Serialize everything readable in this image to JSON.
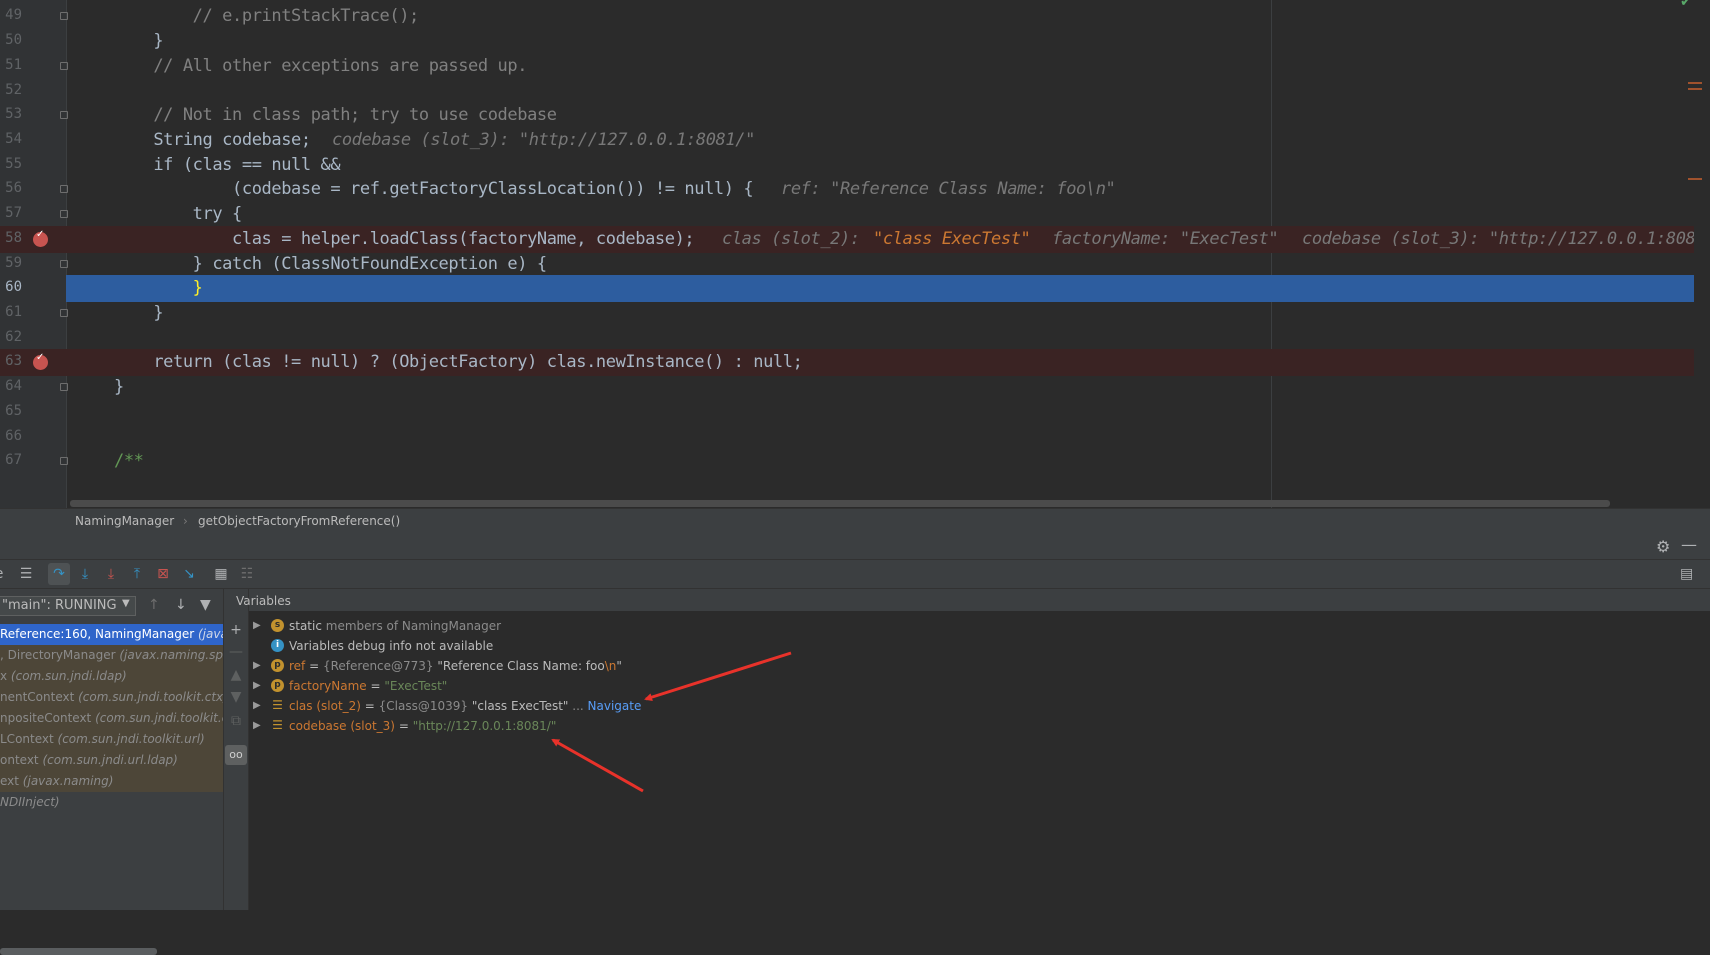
{
  "editor": {
    "lines": [
      {
        "num": "49",
        "code": "        // e.printStackTrace();"
      },
      {
        "num": "50",
        "code": "    }"
      },
      {
        "num": "51",
        "code": "    // All other exceptions are passed up."
      },
      {
        "num": "52",
        "code": ""
      },
      {
        "num": "53",
        "code": "    // Not in class path; try to use codebase"
      },
      {
        "num": "54",
        "code": "    String codebase;",
        "inlay": "codebase (slot_3): \"http://127.0.0.1:8081/\""
      },
      {
        "num": "55",
        "code": "    if (clas == null &&"
      },
      {
        "num": "56",
        "code": "            (codebase = ref.getFactoryClassLocation()) != null) {",
        "inlay": "ref: \"Reference Class Name: foo\\n\""
      },
      {
        "num": "57",
        "code": "        try {"
      },
      {
        "num": "58",
        "code": "            clas = helper.loadClass(factoryName, codebase);",
        "inlay_a": "clas (slot_2): ",
        "inlay_a_val": "\"class ExecTest\"",
        "inlay_b": "factoryName: \"ExecTest\"",
        "inlay_c": "codebase (slot_3): \"http://127.0.0.1:808"
      },
      {
        "num": "59",
        "code": "        } catch (ClassNotFoundException e) {"
      },
      {
        "num": "60",
        "code": "        }"
      },
      {
        "num": "61",
        "code": "    }"
      },
      {
        "num": "62",
        "code": ""
      },
      {
        "num": "63",
        "code": "    return (clas != null) ? (ObjectFactory) clas.newInstance() : null;"
      },
      {
        "num": "64",
        "code": "}"
      },
      {
        "num": "65",
        "code": ""
      },
      {
        "num": "66",
        "code": ""
      },
      {
        "num": "67",
        "code": "/**"
      }
    ]
  },
  "breadcrumb": {
    "class": "NamingManager",
    "method": "getObjectFactoryFromReference()"
  },
  "debug": {
    "thread_label": "\"main\": RUNNING",
    "frames": [
      {
        "method": "Reference:160, NamingManager ",
        "pkg": "(javax.naming.spi)",
        "selected": true
      },
      {
        "method": ", DirectoryManager ",
        "pkg": "(javax.naming.spi)"
      },
      {
        "method": "x ",
        "pkg": "(com.sun.jndi.ldap)"
      },
      {
        "method": "nentContext ",
        "pkg": "(com.sun.jndi.toolkit.ctx)"
      },
      {
        "method": "npositeContext ",
        "pkg": "(com.sun.jndi.toolkit.ctx)"
      },
      {
        "method": "LContext ",
        "pkg": "(com.sun.jndi.toolkit.url)"
      },
      {
        "method": "ontext ",
        "pkg": "(com.sun.jndi.url.ldap)"
      },
      {
        "method": "ext ",
        "pkg": "(javax.naming)"
      },
      {
        "method": "NDIInject)",
        "pkg": ""
      }
    ],
    "variables_header": "Variables",
    "variables": {
      "static": {
        "kw": "static",
        "rest": " members of NamingManager"
      },
      "info": "Variables debug info not available",
      "ref": {
        "name": "ref",
        "eq": " = ",
        "id": "{Reference@773}",
        "val": " \"Reference Class Name: foo",
        "esc": "\\n",
        "tail": "\""
      },
      "factoryName": {
        "name": "factoryName",
        "eq": " = ",
        "val": "\"ExecTest\""
      },
      "clas": {
        "name": "clas (slot_2)",
        "eq": " = ",
        "id": "{Class@1039}",
        "val": " \"class ExecTest\"",
        "more": " ... ",
        "link": "Navigate"
      },
      "codebase": {
        "name": "codebase (slot_3)",
        "eq": " = ",
        "val": "\"http://127.0.0.1:8081/\""
      }
    }
  },
  "colors": {
    "editor_bg": "#2b2b2b",
    "keyword": "#cc7832",
    "string": "#6a8759",
    "comment": "#808080",
    "execution_line": "#2d5d9f",
    "breakpoint_line": "#3a2323",
    "breakpoint": "#c75450",
    "annotation_arrow": "#e8322a"
  }
}
